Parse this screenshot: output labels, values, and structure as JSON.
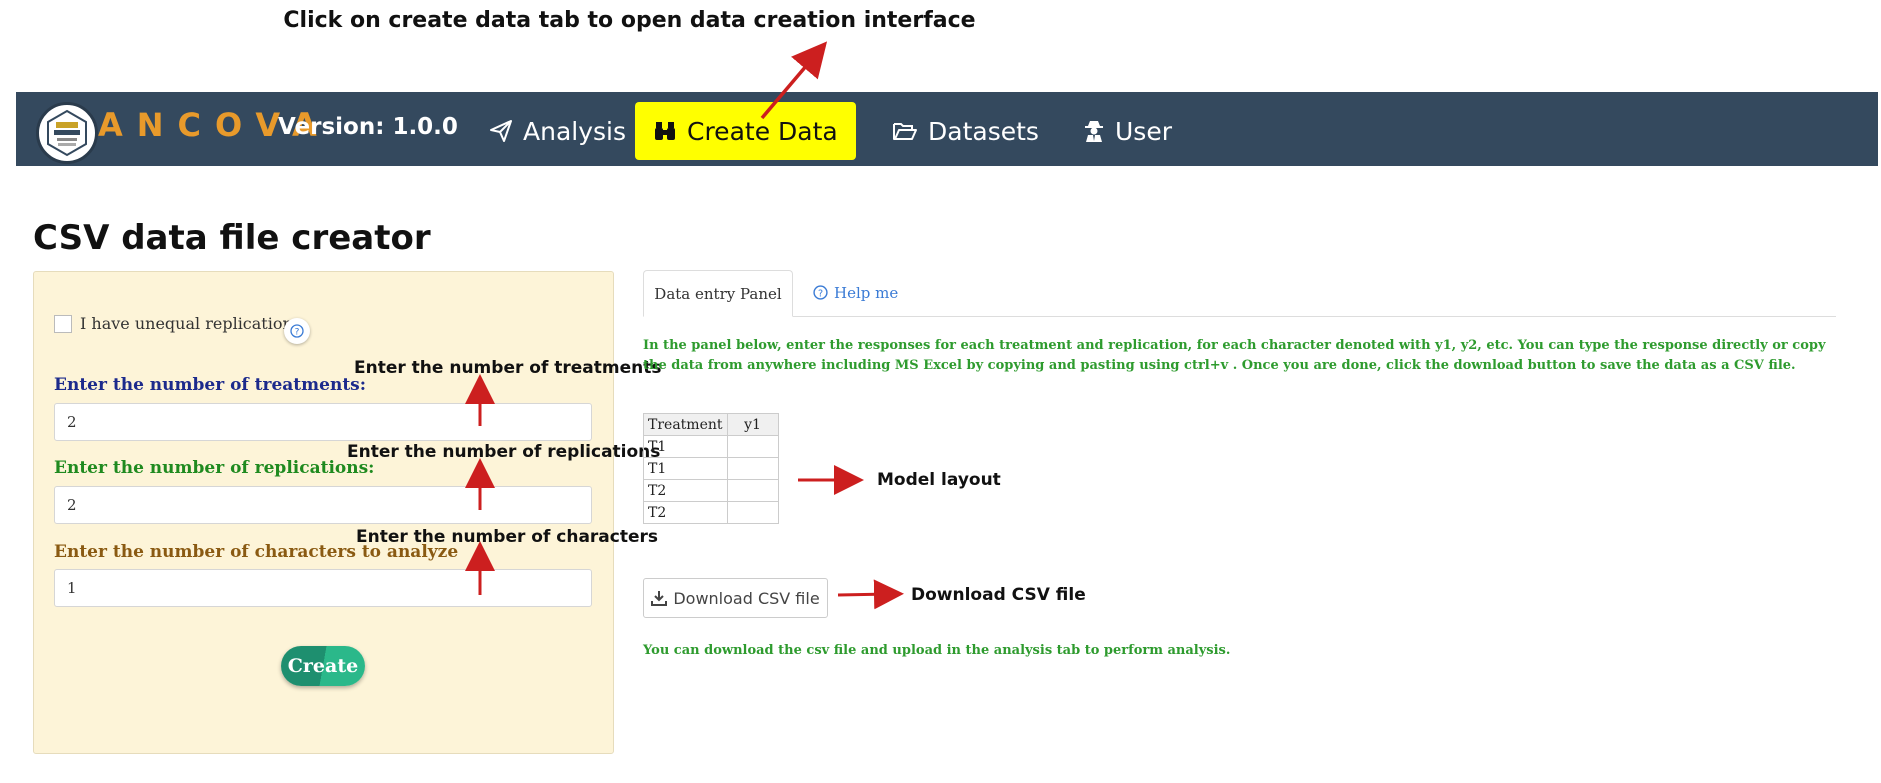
{
  "annotations": {
    "top": "Click on create data tab to open data creation interface",
    "treatments": "Enter the number of treatments",
    "replications": "Enter the number of replications",
    "characters": "Enter the number of characters",
    "model_layout": "Model layout",
    "download": "Download CSV file"
  },
  "navbar": {
    "brand": "ANCOVA",
    "version": "Version: 1.0.0",
    "items": [
      {
        "label": "Analysis",
        "icon": "paper-plane-icon"
      },
      {
        "label": "Create Data",
        "icon": "binoculars-icon",
        "active": true,
        "highlight_color": "#ffff00"
      },
      {
        "label": "Datasets",
        "icon": "folder-open-icon"
      },
      {
        "label": "User",
        "icon": "user-secret-icon"
      }
    ],
    "background": "#34495e"
  },
  "page": {
    "title": "CSV data file creator"
  },
  "sidebar": {
    "checkbox_label": "I have unequal replications",
    "checkbox_checked": false,
    "help_icon": "question-circle-icon",
    "treatments_label": "Enter the number of treatments:",
    "treatments_value": "2",
    "replications_label": "Enter the number of replications:",
    "replications_value": "2",
    "characters_label": "Enter the number of characters to analyze",
    "characters_value": "1",
    "create_button": "Create",
    "background": "#fdf4d8"
  },
  "main": {
    "tabs": [
      {
        "label": "Data entry Panel",
        "active": true
      },
      {
        "label": "Help me",
        "icon": "question-circle-icon"
      }
    ],
    "instructions": "In the panel below, enter the responses for each treatment and replication, for each character denoted with y1, y2, etc. You can type the response directly or copy the data from anywhere including MS Excel by copying and pasting using ctrl+v . Once you are done, click the download button to save the data as a CSV file.",
    "table": {
      "headers": [
        "Treatment",
        "y1"
      ],
      "rows": [
        [
          "T1",
          ""
        ],
        [
          "T1",
          ""
        ],
        [
          "T2",
          ""
        ],
        [
          "T2",
          ""
        ]
      ]
    },
    "download_button": "Download CSV file",
    "footer_note": "You can download the csv file and upload in the analysis tab to perform analysis."
  }
}
